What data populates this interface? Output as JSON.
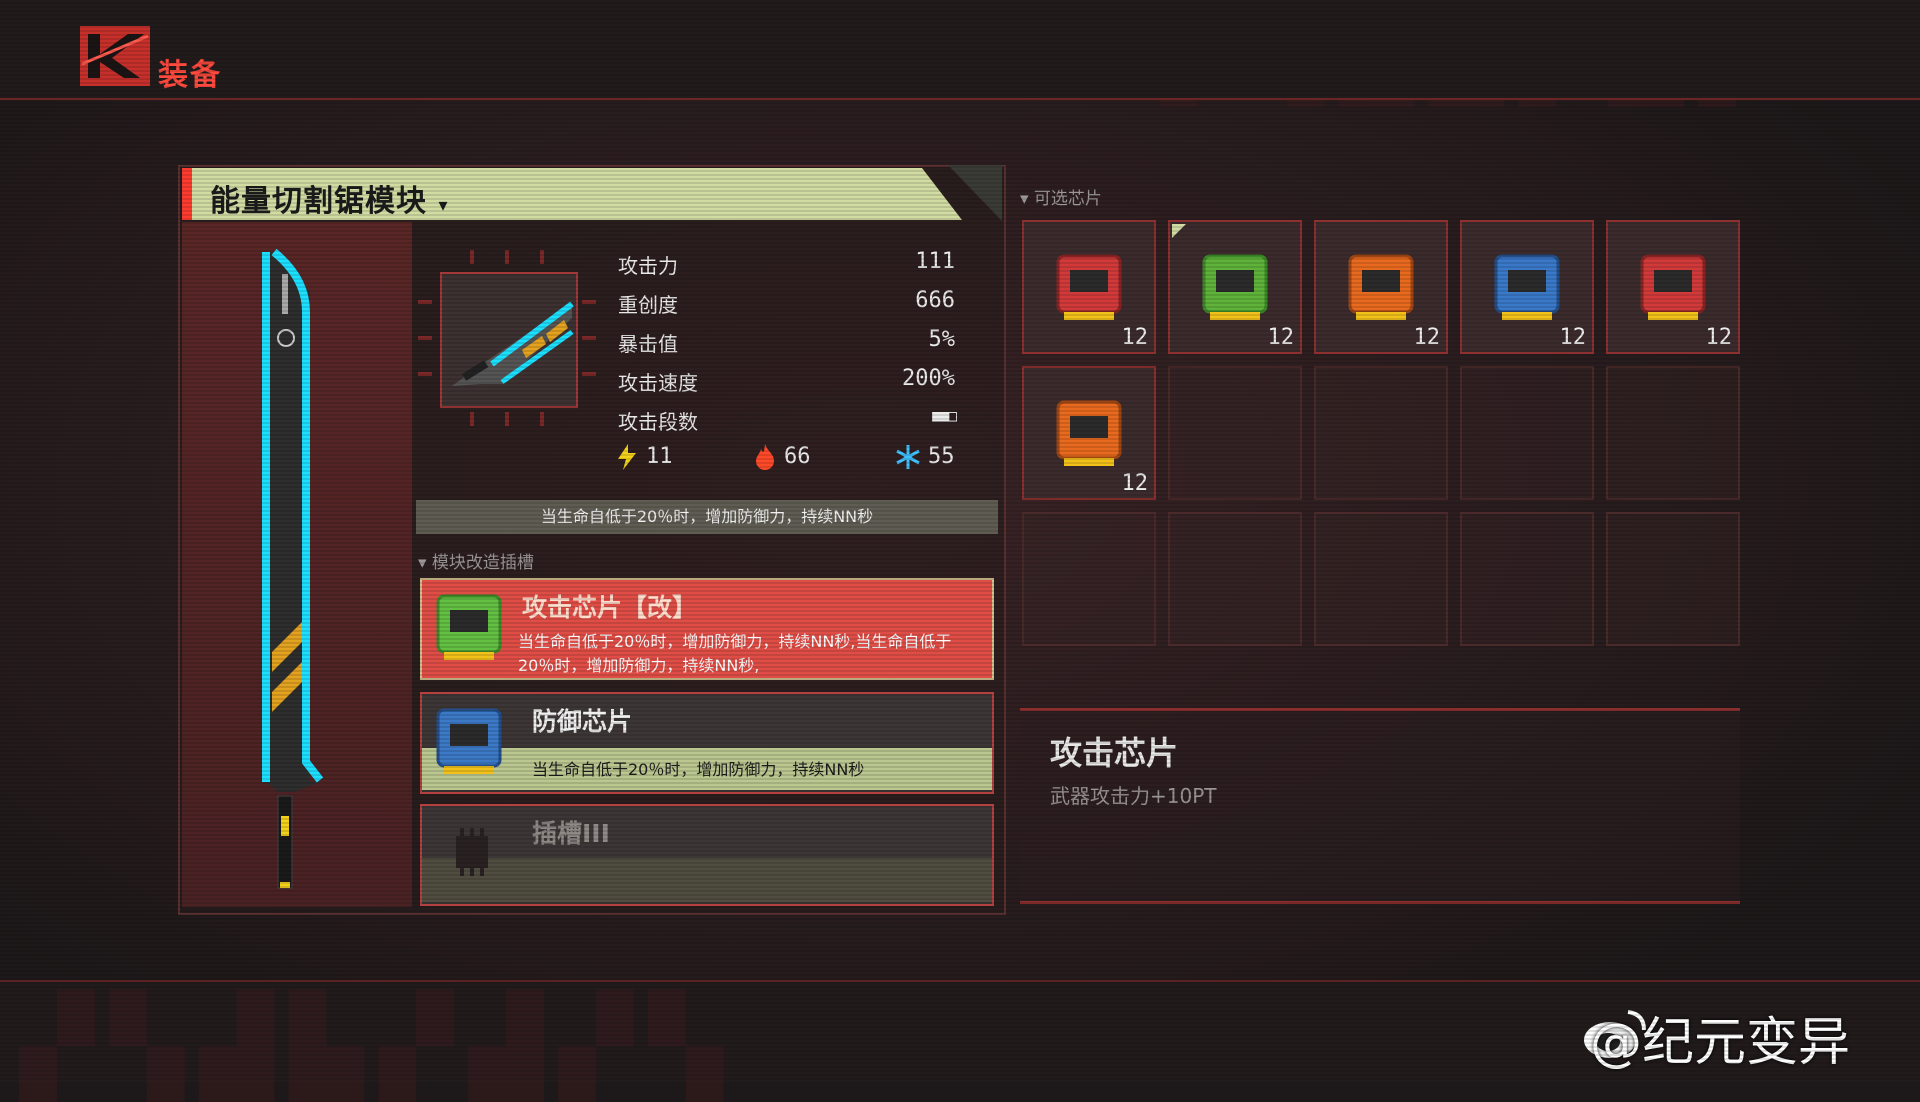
{
  "header": {
    "title": "装备"
  },
  "weapon": {
    "name": "能量切割锯模块",
    "name_caret": "▾",
    "stats": [
      {
        "label": "攻击力",
        "value": "111"
      },
      {
        "label": "重创度",
        "value": "666"
      },
      {
        "label": "暴击值",
        "value": "5%"
      },
      {
        "label": "攻击速度",
        "value": "200%"
      },
      {
        "label": "攻击段数",
        "value": "■■□"
      }
    ],
    "elements": {
      "lightning": "11",
      "fire": "66",
      "ice": "55"
    },
    "description": "当生命自低于20％时，增加防御力，持续NN秒"
  },
  "module_slots": {
    "label": "▾ 模块改造插槽",
    "slots": [
      {
        "title": "攻击芯片【改】",
        "desc": "当生命自低于20％时，增加防御力，持续NN秒,当生命自低于20％时，增加防御力，持续NN秒,",
        "color": "green"
      },
      {
        "title": "防御芯片",
        "desc": "当生命自低于20％时，增加防御力，持续NN秒",
        "color": "blue"
      },
      {
        "title": "插槽III",
        "desc": "",
        "color": "empty"
      }
    ]
  },
  "chips": {
    "label": "▾ 可选芯片",
    "items": [
      {
        "color": "#d23a3a",
        "count": "12"
      },
      {
        "color": "#5fb33a",
        "count": "12"
      },
      {
        "color": "#e86a1e",
        "count": "12"
      },
      {
        "color": "#3a78c8",
        "count": "12"
      },
      {
        "color": "#d23a3a",
        "count": "12"
      },
      {
        "color": "#e86a1e",
        "count": "12"
      }
    ]
  },
  "detail": {
    "title": "攻击芯片",
    "desc": "武器攻击力+10PT"
  },
  "watermark": "@纪元变异",
  "colors": {
    "accent": "#ff3b30",
    "name_bar": "#d1dca3",
    "neon": "#1ce0ff"
  }
}
